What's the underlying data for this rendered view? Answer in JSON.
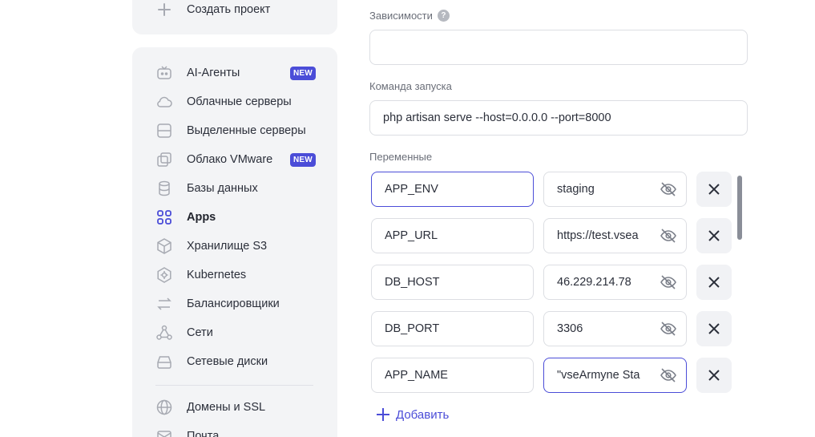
{
  "sidebar": {
    "create_project": "Создать проект",
    "items": [
      {
        "label": "AI-Агенты",
        "icon": "robot-icon",
        "badge": "NEW"
      },
      {
        "label": "Облачные серверы",
        "icon": "cloud-icon"
      },
      {
        "label": "Выделенные серверы",
        "icon": "server-icon"
      },
      {
        "label": "Облако VMware",
        "icon": "vmware-icon",
        "badge": "NEW"
      },
      {
        "label": "Базы данных",
        "icon": "database-icon"
      },
      {
        "label": "Apps",
        "icon": "apps-grid-icon",
        "active": true
      },
      {
        "label": "Хранилище S3",
        "icon": "cube-icon"
      },
      {
        "label": "Kubernetes",
        "icon": "kubernetes-icon"
      },
      {
        "label": "Балансировщики",
        "icon": "arrows-icon"
      },
      {
        "label": "Сети",
        "icon": "network-icon"
      },
      {
        "label": "Сетевые диски",
        "icon": "disk-icon"
      },
      {
        "label": "Домены и SSL",
        "icon": "globe-icon"
      },
      {
        "label": "Почта",
        "icon": "mail-icon"
      }
    ]
  },
  "form": {
    "dependencies": {
      "label": "Зависимости",
      "help": "?",
      "value": ""
    },
    "start_command": {
      "label": "Команда запуска",
      "value": "php artisan serve --host=0.0.0.0 --port=8000"
    },
    "variables": {
      "label": "Переменные",
      "rows": [
        {
          "key": "APP_ENV",
          "value": "staging"
        },
        {
          "key": "APP_URL",
          "value": "https://test.vsea"
        },
        {
          "key": "DB_HOST",
          "value": "46.229.214.78"
        },
        {
          "key": "DB_PORT",
          "value": "3306"
        },
        {
          "key": "APP_NAME",
          "value": "\"vseArmyne Sta"
        }
      ],
      "add_label": "Добавить"
    }
  },
  "colors": {
    "accent": "#4b4dd8",
    "sidebar_bg": "#f3f4f6",
    "icon": "#a7aab2"
  }
}
